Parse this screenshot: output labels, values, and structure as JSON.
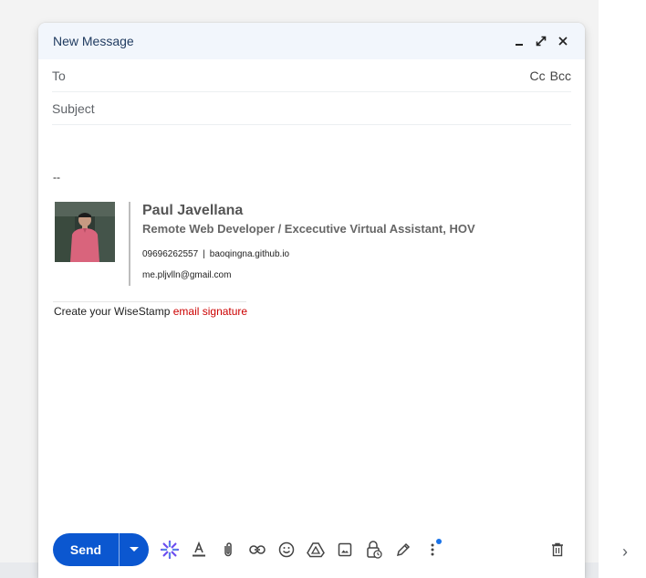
{
  "compose": {
    "title": "New Message",
    "to_label": "To",
    "cc_label": "Cc",
    "bcc_label": "Bcc",
    "subject_placeholder": "Subject",
    "send_label": "Send"
  },
  "signature": {
    "dash": "--",
    "name": "Paul Javellana",
    "role": "Remote Web Developer / Excecutive Virtual Assistant, HOV",
    "phone": "09696262557",
    "separator": "|",
    "website": "baoqingna.github.io",
    "email": "me.pljvlln@gmail.com",
    "promo_text": "Create your WiseStamp ",
    "promo_link": "email signature"
  },
  "icons": {
    "header": [
      "minimize-icon",
      "expand-icon",
      "close-icon"
    ],
    "toolbar": [
      "ai-sparkle-icon",
      "text-format-icon",
      "attach-icon",
      "link-icon",
      "emoji-icon",
      "drive-icon",
      "photo-icon",
      "confidential-lock-icon",
      "signature-pen-icon",
      "more-options-icon",
      "trash-icon"
    ]
  },
  "colors": {
    "send": "#0b57d0",
    "link": "#cc0000",
    "notification_dot": "#1a73e8"
  }
}
